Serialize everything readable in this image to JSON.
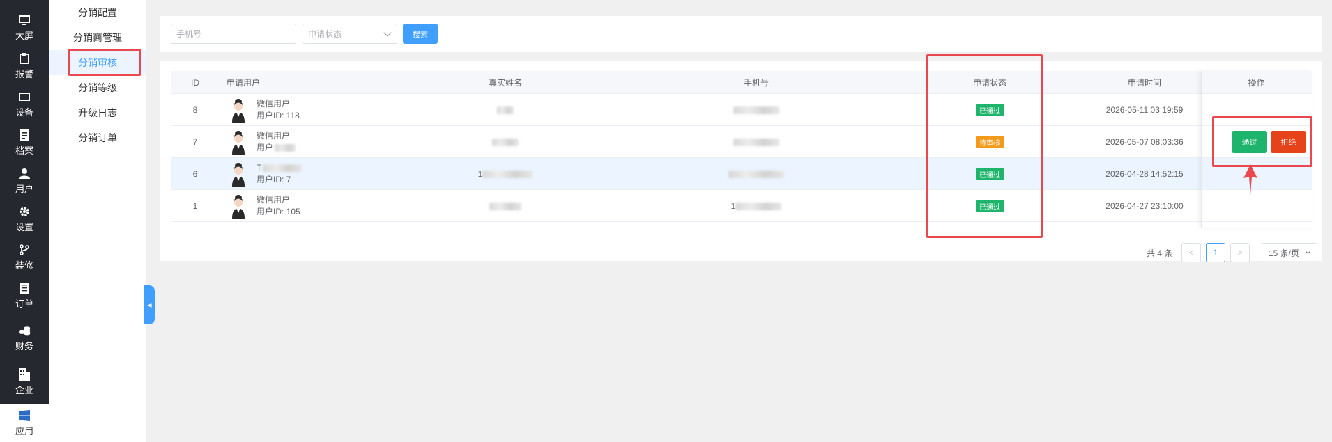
{
  "nav": {
    "items": [
      {
        "label": "大屏",
        "icon": "monitor-icon"
      },
      {
        "label": "报警",
        "icon": "clipboard-icon"
      },
      {
        "label": "设备",
        "icon": "device-icon"
      },
      {
        "label": "档案",
        "icon": "document-icon"
      },
      {
        "label": "用户",
        "icon": "user-icon"
      },
      {
        "label": "设置",
        "icon": "gear-icon"
      },
      {
        "label": "装修",
        "icon": "branch-icon"
      },
      {
        "label": "订单",
        "icon": "order-icon"
      },
      {
        "label": "财务",
        "icon": "coins-icon"
      },
      {
        "label": "企业",
        "icon": "building-icon"
      },
      {
        "label": "应用",
        "icon": "windows-icon"
      }
    ],
    "active_index": 10
  },
  "submenu": {
    "items": [
      "分销配置",
      "分销商管理",
      "分销审核",
      "分销等级",
      "升级日志",
      "分销订单"
    ],
    "active_index": 2
  },
  "search": {
    "phone_placeholder": "手机号",
    "status_placeholder": "申请状态",
    "button": "搜索"
  },
  "table": {
    "columns": [
      "ID",
      "申请用户",
      "真实姓名",
      "手机号",
      "申请状态",
      "申请时间",
      "操作"
    ],
    "rows": [
      {
        "id": "8",
        "user_name": "微信用户",
        "user_id": "用户ID: 118",
        "real_name": "",
        "phone": "",
        "status": "已通过",
        "time": "2026-05-11 03:19:59"
      },
      {
        "id": "7",
        "user_name": "微信用户",
        "user_id": "用户",
        "real_name": "",
        "phone": "",
        "status": "待审核",
        "time": "2026-05-07 08:03:36"
      },
      {
        "id": "6",
        "user_name": "T",
        "user_id": "用户ID: 7",
        "real_name": "1",
        "phone": "",
        "status": "已通过",
        "time": "2026-04-28 14:52:15"
      },
      {
        "id": "1",
        "user_name": "微信用户",
        "user_id": "用户ID: 105",
        "real_name": "",
        "phone": "1",
        "status": "已通过",
        "time": "2026-04-27 23:10:00"
      }
    ],
    "actions": {
      "pass": "通过",
      "reject": "拒绝"
    }
  },
  "pagination": {
    "total": "共 4 条",
    "prev": "<",
    "current": "1",
    "next": ">",
    "page_size": "15 条/页"
  },
  "colors": {
    "accent": "#409eff",
    "nav_bg": "#26282f",
    "success": "#1fb46b",
    "warning": "#f49a1a",
    "danger": "#e7431b",
    "annotation": "#e8484e"
  }
}
